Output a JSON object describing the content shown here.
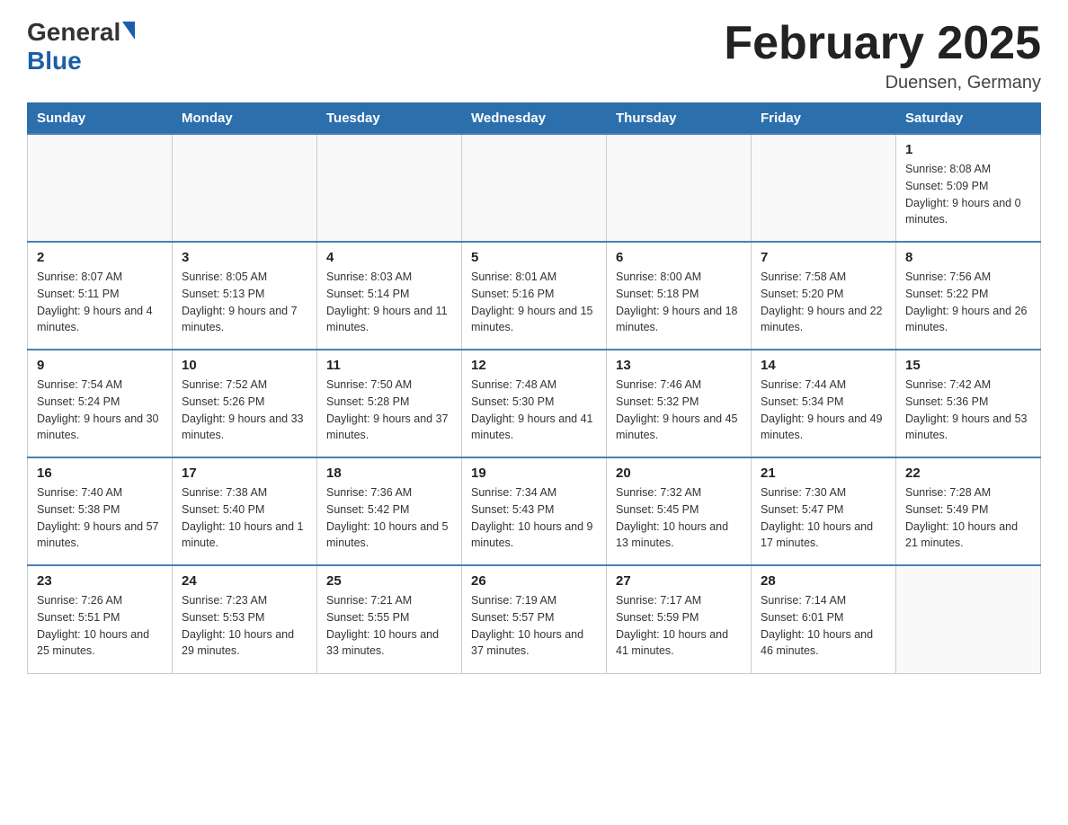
{
  "header": {
    "logo_general": "General",
    "logo_blue": "Blue",
    "month_title": "February 2025",
    "location": "Duensen, Germany"
  },
  "days_of_week": [
    "Sunday",
    "Monday",
    "Tuesday",
    "Wednesday",
    "Thursday",
    "Friday",
    "Saturday"
  ],
  "weeks": [
    [
      {
        "day": "",
        "info": ""
      },
      {
        "day": "",
        "info": ""
      },
      {
        "day": "",
        "info": ""
      },
      {
        "day": "",
        "info": ""
      },
      {
        "day": "",
        "info": ""
      },
      {
        "day": "",
        "info": ""
      },
      {
        "day": "1",
        "info": "Sunrise: 8:08 AM\nSunset: 5:09 PM\nDaylight: 9 hours and 0 minutes."
      }
    ],
    [
      {
        "day": "2",
        "info": "Sunrise: 8:07 AM\nSunset: 5:11 PM\nDaylight: 9 hours and 4 minutes."
      },
      {
        "day": "3",
        "info": "Sunrise: 8:05 AM\nSunset: 5:13 PM\nDaylight: 9 hours and 7 minutes."
      },
      {
        "day": "4",
        "info": "Sunrise: 8:03 AM\nSunset: 5:14 PM\nDaylight: 9 hours and 11 minutes."
      },
      {
        "day": "5",
        "info": "Sunrise: 8:01 AM\nSunset: 5:16 PM\nDaylight: 9 hours and 15 minutes."
      },
      {
        "day": "6",
        "info": "Sunrise: 8:00 AM\nSunset: 5:18 PM\nDaylight: 9 hours and 18 minutes."
      },
      {
        "day": "7",
        "info": "Sunrise: 7:58 AM\nSunset: 5:20 PM\nDaylight: 9 hours and 22 minutes."
      },
      {
        "day": "8",
        "info": "Sunrise: 7:56 AM\nSunset: 5:22 PM\nDaylight: 9 hours and 26 minutes."
      }
    ],
    [
      {
        "day": "9",
        "info": "Sunrise: 7:54 AM\nSunset: 5:24 PM\nDaylight: 9 hours and 30 minutes."
      },
      {
        "day": "10",
        "info": "Sunrise: 7:52 AM\nSunset: 5:26 PM\nDaylight: 9 hours and 33 minutes."
      },
      {
        "day": "11",
        "info": "Sunrise: 7:50 AM\nSunset: 5:28 PM\nDaylight: 9 hours and 37 minutes."
      },
      {
        "day": "12",
        "info": "Sunrise: 7:48 AM\nSunset: 5:30 PM\nDaylight: 9 hours and 41 minutes."
      },
      {
        "day": "13",
        "info": "Sunrise: 7:46 AM\nSunset: 5:32 PM\nDaylight: 9 hours and 45 minutes."
      },
      {
        "day": "14",
        "info": "Sunrise: 7:44 AM\nSunset: 5:34 PM\nDaylight: 9 hours and 49 minutes."
      },
      {
        "day": "15",
        "info": "Sunrise: 7:42 AM\nSunset: 5:36 PM\nDaylight: 9 hours and 53 minutes."
      }
    ],
    [
      {
        "day": "16",
        "info": "Sunrise: 7:40 AM\nSunset: 5:38 PM\nDaylight: 9 hours and 57 minutes."
      },
      {
        "day": "17",
        "info": "Sunrise: 7:38 AM\nSunset: 5:40 PM\nDaylight: 10 hours and 1 minute."
      },
      {
        "day": "18",
        "info": "Sunrise: 7:36 AM\nSunset: 5:42 PM\nDaylight: 10 hours and 5 minutes."
      },
      {
        "day": "19",
        "info": "Sunrise: 7:34 AM\nSunset: 5:43 PM\nDaylight: 10 hours and 9 minutes."
      },
      {
        "day": "20",
        "info": "Sunrise: 7:32 AM\nSunset: 5:45 PM\nDaylight: 10 hours and 13 minutes."
      },
      {
        "day": "21",
        "info": "Sunrise: 7:30 AM\nSunset: 5:47 PM\nDaylight: 10 hours and 17 minutes."
      },
      {
        "day": "22",
        "info": "Sunrise: 7:28 AM\nSunset: 5:49 PM\nDaylight: 10 hours and 21 minutes."
      }
    ],
    [
      {
        "day": "23",
        "info": "Sunrise: 7:26 AM\nSunset: 5:51 PM\nDaylight: 10 hours and 25 minutes."
      },
      {
        "day": "24",
        "info": "Sunrise: 7:23 AM\nSunset: 5:53 PM\nDaylight: 10 hours and 29 minutes."
      },
      {
        "day": "25",
        "info": "Sunrise: 7:21 AM\nSunset: 5:55 PM\nDaylight: 10 hours and 33 minutes."
      },
      {
        "day": "26",
        "info": "Sunrise: 7:19 AM\nSunset: 5:57 PM\nDaylight: 10 hours and 37 minutes."
      },
      {
        "day": "27",
        "info": "Sunrise: 7:17 AM\nSunset: 5:59 PM\nDaylight: 10 hours and 41 minutes."
      },
      {
        "day": "28",
        "info": "Sunrise: 7:14 AM\nSunset: 6:01 PM\nDaylight: 10 hours and 46 minutes."
      },
      {
        "day": "",
        "info": ""
      }
    ]
  ]
}
